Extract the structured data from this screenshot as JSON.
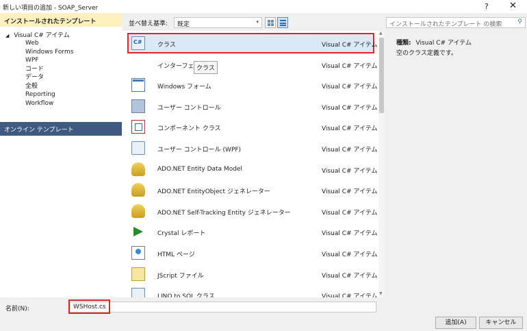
{
  "window": {
    "title": "新しい項目の追加 - SOAP_Server",
    "help": "?",
    "close": "✕"
  },
  "left": {
    "header": "インストールされたテンプレート",
    "root_arrow": "◢",
    "root": "Visual C# アイテム",
    "children": [
      "Web",
      "Windows Forms",
      "WPF",
      "コード",
      "データ",
      "全般",
      "Reporting",
      "Workflow"
    ],
    "online": "オンライン テンプレート"
  },
  "toolbar": {
    "sort_label": "並べ替え基準:",
    "sort_value": "既定",
    "sort_chevron": "▾"
  },
  "tooltip": "クラス",
  "items": [
    {
      "name": "クラス",
      "type": "Visual C# アイテム",
      "icon": "class-icon"
    },
    {
      "name": "インターフェイス",
      "type": "Visual C# アイテム",
      "icon": "interface-icon"
    },
    {
      "name": "Windows フォーム",
      "type": "Visual C# アイテム",
      "icon": "windows-form-icon"
    },
    {
      "name": "ユーザー コントロール",
      "type": "Visual C# アイテム",
      "icon": "user-control-icon"
    },
    {
      "name": "コンポーネント クラス",
      "type": "Visual C# アイテム",
      "icon": "component-icon"
    },
    {
      "name": "ユーザー コントロール (WPF)",
      "type": "Visual C# アイテム",
      "icon": "wpf-user-control-icon"
    },
    {
      "name": "ADO.NET Entity Data Model",
      "type": "Visual C# アイテム",
      "icon": "database-icon"
    },
    {
      "name": "ADO.NET EntityObject ジェネレーター",
      "type": "Visual C# アイテム",
      "icon": "database-icon"
    },
    {
      "name": "ADO.NET Self-Tracking Entity ジェネレーター",
      "type": "Visual C# アイテム",
      "icon": "database-icon"
    },
    {
      "name": "Crystal レポート",
      "type": "Visual C# アイテム",
      "icon": "crystal-report-icon"
    },
    {
      "name": "HTML ページ",
      "type": "Visual C# アイテム",
      "icon": "html-page-icon"
    },
    {
      "name": "JScript ファイル",
      "type": "Visual C# アイテム",
      "icon": "jscript-icon"
    },
    {
      "name": "LINQ to SQL クラス",
      "type": "Visual C# アイテム",
      "icon": "linq-icon"
    }
  ],
  "selected_index": 0,
  "search": {
    "placeholder": "インストールされたテンプレート の検索",
    "icon": "⚲"
  },
  "details": {
    "type_label": "種類:",
    "type_value": "Visual C# アイテム",
    "description": "空のクラス定義です。"
  },
  "bottom": {
    "name_label": "名前(N):",
    "name_value": "WSHost.cs",
    "add_button": "追加(A)",
    "cancel_button": "キャンセル"
  },
  "colors": {
    "highlight_border": "#e0232f",
    "selected_bg": "#dbe9f7",
    "online_bg": "#3e5a80",
    "header_bg": "#fff0c0"
  }
}
